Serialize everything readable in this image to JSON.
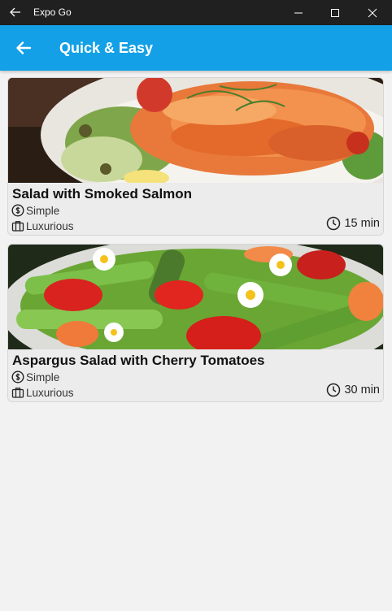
{
  "window": {
    "app_title": "Expo Go"
  },
  "header": {
    "title": "Quick & Easy"
  },
  "meals": [
    {
      "title": "Salad with Smoked Salmon",
      "complexity": "Simple",
      "affordability": "Luxurious",
      "duration": "15 min"
    },
    {
      "title": "Aspargus Salad with Cherry Tomatoes",
      "complexity": "Simple",
      "affordability": "Luxurious",
      "duration": "30 min"
    }
  ],
  "colors": {
    "titlebar_bg": "#202020",
    "header_bg": "#13a0e6",
    "page_bg": "#f2f2f2",
    "card_bg": "#ececec"
  }
}
